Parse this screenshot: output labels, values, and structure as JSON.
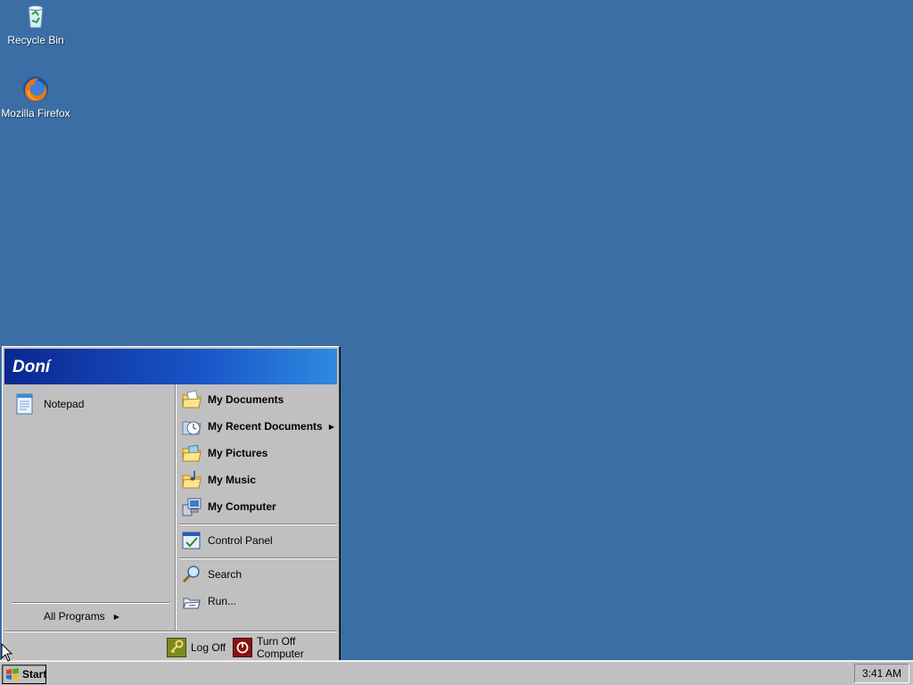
{
  "desktop": {
    "background_color": "#3a6ea5",
    "icons": [
      {
        "label": "Recycle Bin",
        "icon": "recycle-bin-icon"
      },
      {
        "label": "Mozilla Firefox",
        "icon": "firefox-icon"
      }
    ]
  },
  "start_menu": {
    "user_name": "Doní",
    "pinned": [
      {
        "label": "Notepad",
        "icon": "notepad-icon"
      }
    ],
    "all_programs_label": "All Programs",
    "places": [
      {
        "label": "My Documents",
        "icon": "my-documents-icon"
      },
      {
        "label": "My Recent Documents",
        "icon": "recent-documents-icon",
        "has_submenu": true
      },
      {
        "label": "My Pictures",
        "icon": "my-pictures-icon"
      },
      {
        "label": "My Music",
        "icon": "my-music-icon"
      },
      {
        "label": "My Computer",
        "icon": "my-computer-icon"
      }
    ],
    "control_panel_label": "Control Panel",
    "search_label": "Search",
    "run_label": "Run...",
    "log_off_label": "Log Off",
    "turn_off_label": "Turn Off Computer"
  },
  "taskbar": {
    "start_label": "Start",
    "clock": "3:41 AM"
  }
}
